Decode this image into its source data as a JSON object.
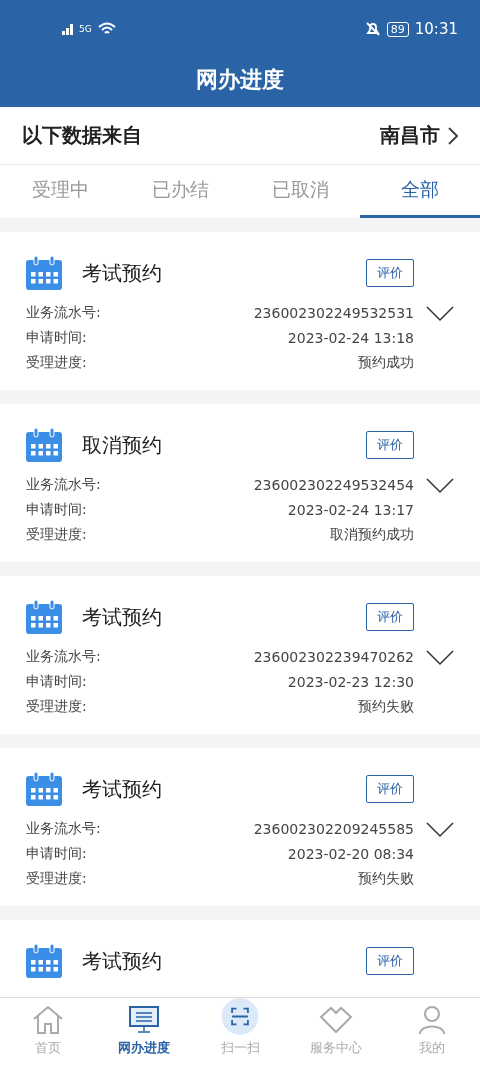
{
  "status_bar": {
    "network": "5G",
    "battery": "89",
    "time": "10:31"
  },
  "title": "网办进度",
  "source": {
    "label": "以下数据来自",
    "city": "南昌市"
  },
  "tabs": [
    {
      "label": "受理中",
      "selected": false
    },
    {
      "label": "已办结",
      "selected": false
    },
    {
      "label": "已取消",
      "selected": false
    },
    {
      "label": "全部",
      "selected": true
    }
  ],
  "records": [
    {
      "title": "考试预约",
      "rate_button": "评价",
      "fields": [
        {
          "label": "业务流水号:",
          "value": "236002302249532531"
        },
        {
          "label": "申请时间:",
          "value": "2023-02-24 13:18"
        },
        {
          "label": "受理进度:",
          "value": "预约成功"
        }
      ]
    },
    {
      "title": "取消预约",
      "rate_button": "评价",
      "fields": [
        {
          "label": "业务流水号:",
          "value": "236002302249532454"
        },
        {
          "label": "申请时间:",
          "value": "2023-02-24 13:17"
        },
        {
          "label": "受理进度:",
          "value": "取消预约成功"
        }
      ]
    },
    {
      "title": "考试预约",
      "rate_button": "评价",
      "fields": [
        {
          "label": "业务流水号:",
          "value": "236002302239470262"
        },
        {
          "label": "申请时间:",
          "value": "2023-02-23 12:30"
        },
        {
          "label": "受理进度:",
          "value": "预约失败"
        }
      ]
    },
    {
      "title": "考试预约",
      "rate_button": "评价",
      "fields": [
        {
          "label": "业务流水号:",
          "value": "236002302209245585"
        },
        {
          "label": "申请时间:",
          "value": "2023-02-20 08:34"
        },
        {
          "label": "受理进度:",
          "value": "预约失败"
        }
      ]
    },
    {
      "title": "考试预约",
      "rate_button": "评价"
    }
  ],
  "bottom_nav": [
    {
      "kind": "home",
      "label": "首页",
      "selected": false
    },
    {
      "kind": "progress",
      "label": "网办进度",
      "selected": true
    },
    {
      "kind": "scan",
      "label": "扫一扫",
      "selected": false
    },
    {
      "kind": "service",
      "label": "服务中心",
      "selected": false
    },
    {
      "kind": "profile",
      "label": "我的",
      "selected": false
    }
  ]
}
